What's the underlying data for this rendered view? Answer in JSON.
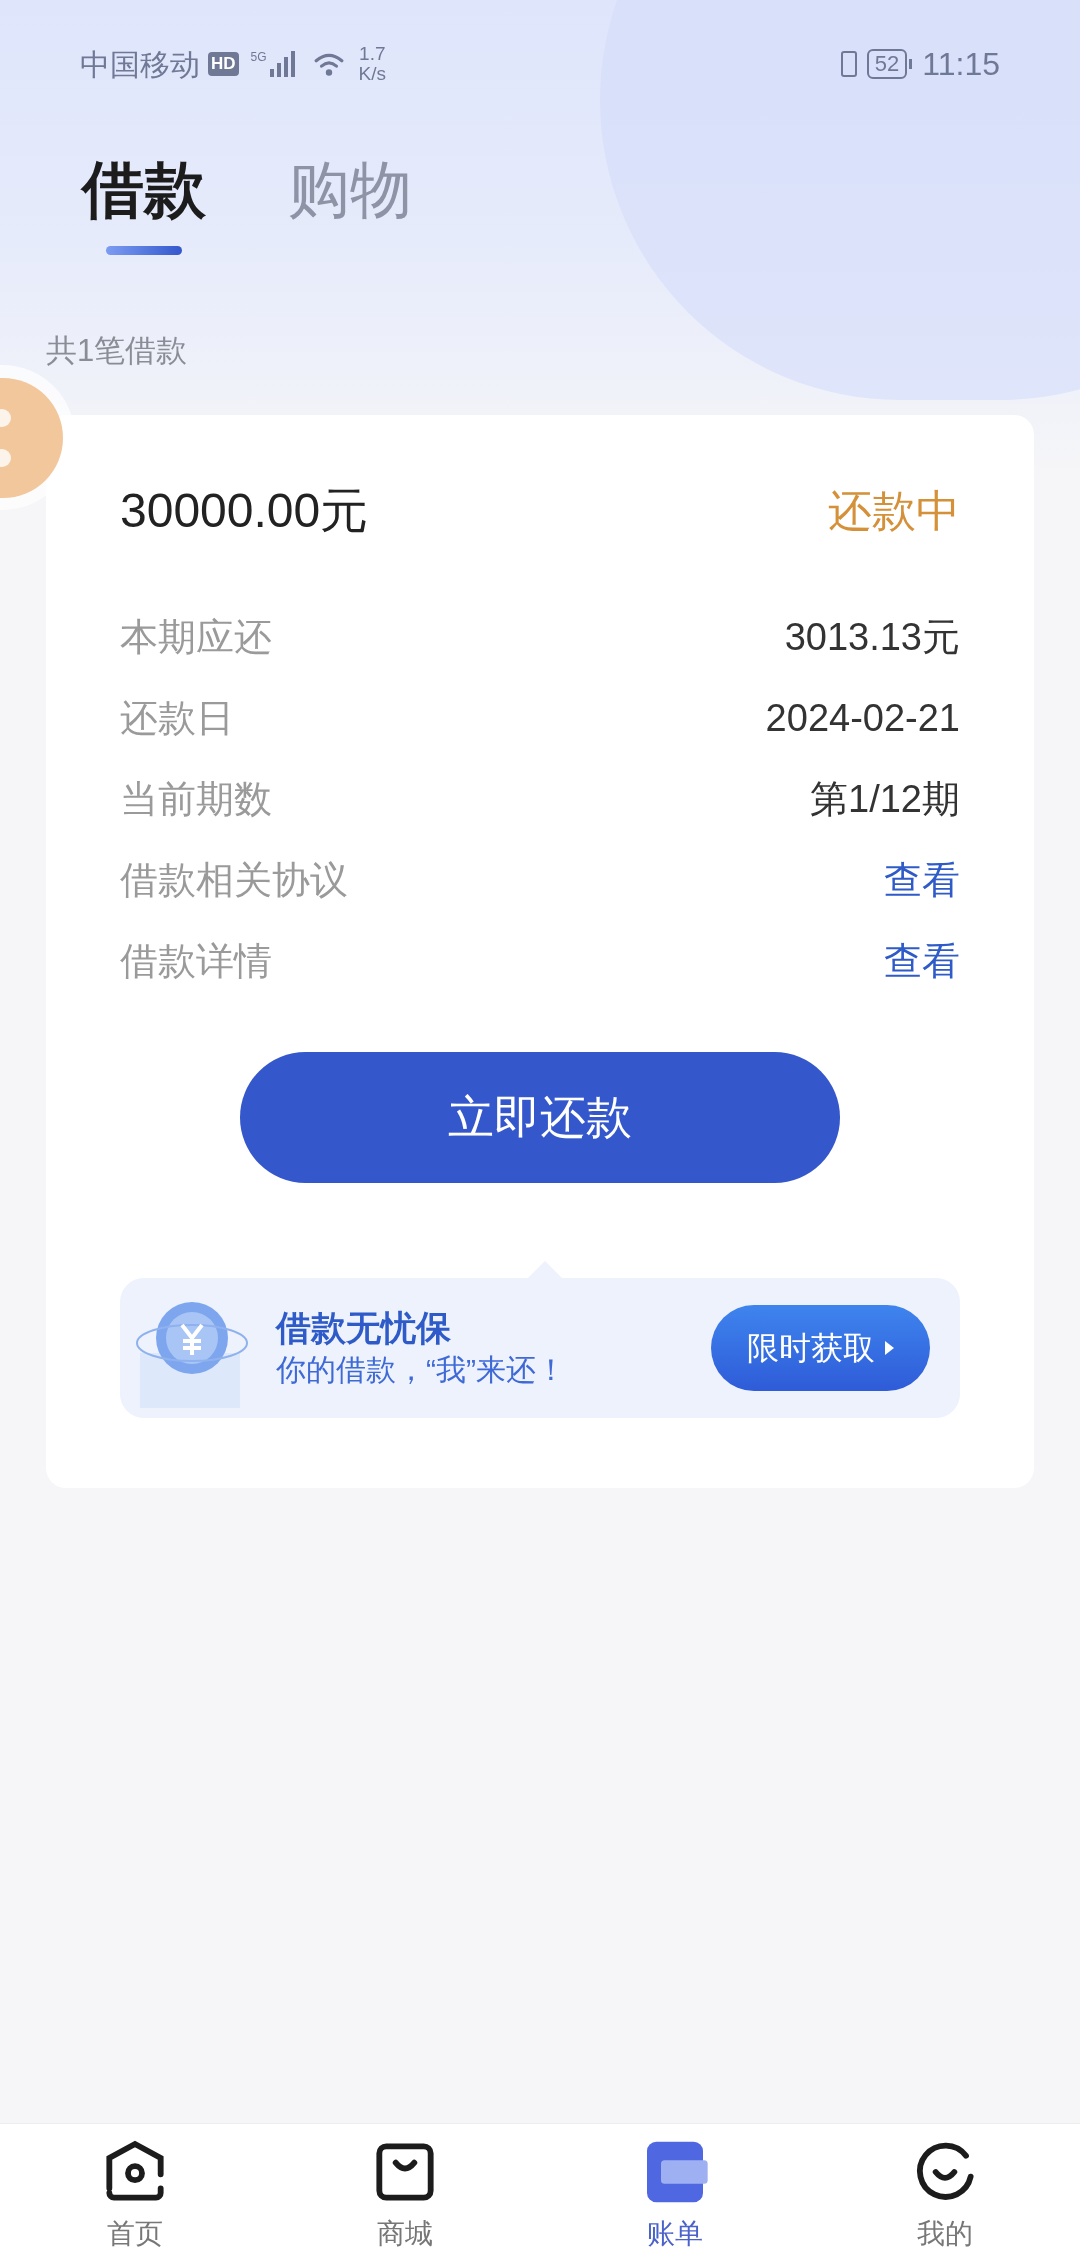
{
  "status_bar": {
    "carrier": "中国移动",
    "hd": "HD",
    "network": "5G",
    "speed_value": "1.7",
    "speed_unit": "K/s",
    "battery": "52",
    "time": "11:15"
  },
  "tabs": [
    {
      "label": "借款",
      "selected": true
    },
    {
      "label": "购物",
      "selected": false
    }
  ],
  "summary": "共1笔借款",
  "loan": {
    "amount": "30000.00元",
    "status": "还款中",
    "rows": [
      {
        "label": "本期应还",
        "value": "3013.13元",
        "kind": "text"
      },
      {
        "label": "还款日",
        "value": "2024-02-21",
        "kind": "text"
      },
      {
        "label": "当前期数",
        "value": "第1/12期",
        "kind": "text"
      },
      {
        "label": "借款相关协议",
        "value": "查看",
        "kind": "link"
      },
      {
        "label": "借款详情",
        "value": "查看",
        "kind": "link"
      }
    ],
    "button": "立即还款",
    "promo": {
      "title": "借款无忧保",
      "subtitle": "你的借款，“我”来还！",
      "button": "限时获取"
    }
  },
  "nav": [
    {
      "label": "首页",
      "selected": false
    },
    {
      "label": "商城",
      "selected": false
    },
    {
      "label": "账单",
      "selected": true
    },
    {
      "label": "我的",
      "selected": false
    }
  ]
}
